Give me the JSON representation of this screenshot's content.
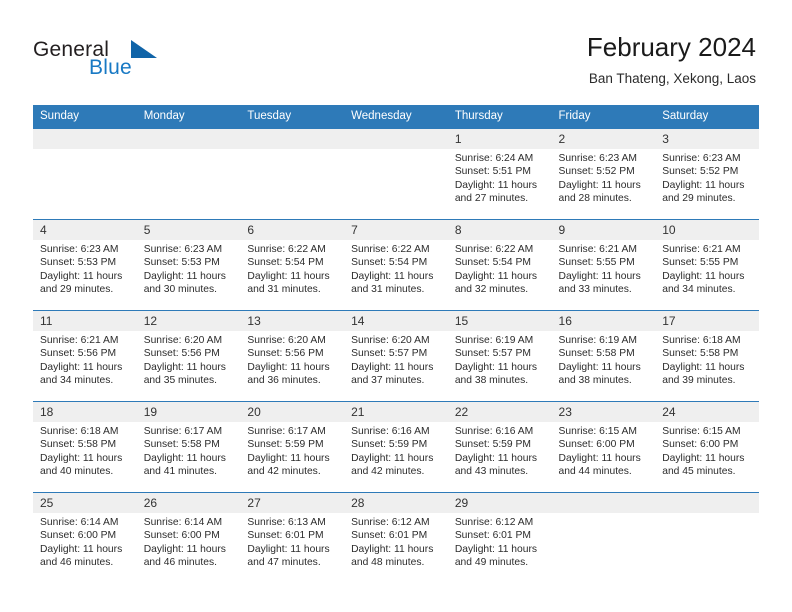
{
  "brand": {
    "word1": "General",
    "word2": "Blue",
    "logo_icon": "triangle-logo-icon",
    "accent_color": "#1879c4",
    "triangle_color": "#1064a8"
  },
  "header": {
    "month_title": "February 2024",
    "location": "Ban Thateng, Xekong, Laos"
  },
  "calendar": {
    "header_bg": "#2e7ab8",
    "daynum_bg": "#efefef",
    "weekday_headers": [
      "Sunday",
      "Monday",
      "Tuesday",
      "Wednesday",
      "Thursday",
      "Friday",
      "Saturday"
    ],
    "weeks": [
      [
        {
          "day": "",
          "sunrise": "",
          "sunset": "",
          "daylight1": "",
          "daylight2": ""
        },
        {
          "day": "",
          "sunrise": "",
          "sunset": "",
          "daylight1": "",
          "daylight2": ""
        },
        {
          "day": "",
          "sunrise": "",
          "sunset": "",
          "daylight1": "",
          "daylight2": ""
        },
        {
          "day": "",
          "sunrise": "",
          "sunset": "",
          "daylight1": "",
          "daylight2": ""
        },
        {
          "day": "1",
          "sunrise": "Sunrise: 6:24 AM",
          "sunset": "Sunset: 5:51 PM",
          "daylight1": "Daylight: 11 hours",
          "daylight2": "and 27 minutes."
        },
        {
          "day": "2",
          "sunrise": "Sunrise: 6:23 AM",
          "sunset": "Sunset: 5:52 PM",
          "daylight1": "Daylight: 11 hours",
          "daylight2": "and 28 minutes."
        },
        {
          "day": "3",
          "sunrise": "Sunrise: 6:23 AM",
          "sunset": "Sunset: 5:52 PM",
          "daylight1": "Daylight: 11 hours",
          "daylight2": "and 29 minutes."
        }
      ],
      [
        {
          "day": "4",
          "sunrise": "Sunrise: 6:23 AM",
          "sunset": "Sunset: 5:53 PM",
          "daylight1": "Daylight: 11 hours",
          "daylight2": "and 29 minutes."
        },
        {
          "day": "5",
          "sunrise": "Sunrise: 6:23 AM",
          "sunset": "Sunset: 5:53 PM",
          "daylight1": "Daylight: 11 hours",
          "daylight2": "and 30 minutes."
        },
        {
          "day": "6",
          "sunrise": "Sunrise: 6:22 AM",
          "sunset": "Sunset: 5:54 PM",
          "daylight1": "Daylight: 11 hours",
          "daylight2": "and 31 minutes."
        },
        {
          "day": "7",
          "sunrise": "Sunrise: 6:22 AM",
          "sunset": "Sunset: 5:54 PM",
          "daylight1": "Daylight: 11 hours",
          "daylight2": "and 31 minutes."
        },
        {
          "day": "8",
          "sunrise": "Sunrise: 6:22 AM",
          "sunset": "Sunset: 5:54 PM",
          "daylight1": "Daylight: 11 hours",
          "daylight2": "and 32 minutes."
        },
        {
          "day": "9",
          "sunrise": "Sunrise: 6:21 AM",
          "sunset": "Sunset: 5:55 PM",
          "daylight1": "Daylight: 11 hours",
          "daylight2": "and 33 minutes."
        },
        {
          "day": "10",
          "sunrise": "Sunrise: 6:21 AM",
          "sunset": "Sunset: 5:55 PM",
          "daylight1": "Daylight: 11 hours",
          "daylight2": "and 34 minutes."
        }
      ],
      [
        {
          "day": "11",
          "sunrise": "Sunrise: 6:21 AM",
          "sunset": "Sunset: 5:56 PM",
          "daylight1": "Daylight: 11 hours",
          "daylight2": "and 34 minutes."
        },
        {
          "day": "12",
          "sunrise": "Sunrise: 6:20 AM",
          "sunset": "Sunset: 5:56 PM",
          "daylight1": "Daylight: 11 hours",
          "daylight2": "and 35 minutes."
        },
        {
          "day": "13",
          "sunrise": "Sunrise: 6:20 AM",
          "sunset": "Sunset: 5:56 PM",
          "daylight1": "Daylight: 11 hours",
          "daylight2": "and 36 minutes."
        },
        {
          "day": "14",
          "sunrise": "Sunrise: 6:20 AM",
          "sunset": "Sunset: 5:57 PM",
          "daylight1": "Daylight: 11 hours",
          "daylight2": "and 37 minutes."
        },
        {
          "day": "15",
          "sunrise": "Sunrise: 6:19 AM",
          "sunset": "Sunset: 5:57 PM",
          "daylight1": "Daylight: 11 hours",
          "daylight2": "and 38 minutes."
        },
        {
          "day": "16",
          "sunrise": "Sunrise: 6:19 AM",
          "sunset": "Sunset: 5:58 PM",
          "daylight1": "Daylight: 11 hours",
          "daylight2": "and 38 minutes."
        },
        {
          "day": "17",
          "sunrise": "Sunrise: 6:18 AM",
          "sunset": "Sunset: 5:58 PM",
          "daylight1": "Daylight: 11 hours",
          "daylight2": "and 39 minutes."
        }
      ],
      [
        {
          "day": "18",
          "sunrise": "Sunrise: 6:18 AM",
          "sunset": "Sunset: 5:58 PM",
          "daylight1": "Daylight: 11 hours",
          "daylight2": "and 40 minutes."
        },
        {
          "day": "19",
          "sunrise": "Sunrise: 6:17 AM",
          "sunset": "Sunset: 5:58 PM",
          "daylight1": "Daylight: 11 hours",
          "daylight2": "and 41 minutes."
        },
        {
          "day": "20",
          "sunrise": "Sunrise: 6:17 AM",
          "sunset": "Sunset: 5:59 PM",
          "daylight1": "Daylight: 11 hours",
          "daylight2": "and 42 minutes."
        },
        {
          "day": "21",
          "sunrise": "Sunrise: 6:16 AM",
          "sunset": "Sunset: 5:59 PM",
          "daylight1": "Daylight: 11 hours",
          "daylight2": "and 42 minutes."
        },
        {
          "day": "22",
          "sunrise": "Sunrise: 6:16 AM",
          "sunset": "Sunset: 5:59 PM",
          "daylight1": "Daylight: 11 hours",
          "daylight2": "and 43 minutes."
        },
        {
          "day": "23",
          "sunrise": "Sunrise: 6:15 AM",
          "sunset": "Sunset: 6:00 PM",
          "daylight1": "Daylight: 11 hours",
          "daylight2": "and 44 minutes."
        },
        {
          "day": "24",
          "sunrise": "Sunrise: 6:15 AM",
          "sunset": "Sunset: 6:00 PM",
          "daylight1": "Daylight: 11 hours",
          "daylight2": "and 45 minutes."
        }
      ],
      [
        {
          "day": "25",
          "sunrise": "Sunrise: 6:14 AM",
          "sunset": "Sunset: 6:00 PM",
          "daylight1": "Daylight: 11 hours",
          "daylight2": "and 46 minutes."
        },
        {
          "day": "26",
          "sunrise": "Sunrise: 6:14 AM",
          "sunset": "Sunset: 6:00 PM",
          "daylight1": "Daylight: 11 hours",
          "daylight2": "and 46 minutes."
        },
        {
          "day": "27",
          "sunrise": "Sunrise: 6:13 AM",
          "sunset": "Sunset: 6:01 PM",
          "daylight1": "Daylight: 11 hours",
          "daylight2": "and 47 minutes."
        },
        {
          "day": "28",
          "sunrise": "Sunrise: 6:12 AM",
          "sunset": "Sunset: 6:01 PM",
          "daylight1": "Daylight: 11 hours",
          "daylight2": "and 48 minutes."
        },
        {
          "day": "29",
          "sunrise": "Sunrise: 6:12 AM",
          "sunset": "Sunset: 6:01 PM",
          "daylight1": "Daylight: 11 hours",
          "daylight2": "and 49 minutes."
        },
        {
          "day": "",
          "sunrise": "",
          "sunset": "",
          "daylight1": "",
          "daylight2": ""
        },
        {
          "day": "",
          "sunrise": "",
          "sunset": "",
          "daylight1": "",
          "daylight2": ""
        }
      ]
    ]
  }
}
